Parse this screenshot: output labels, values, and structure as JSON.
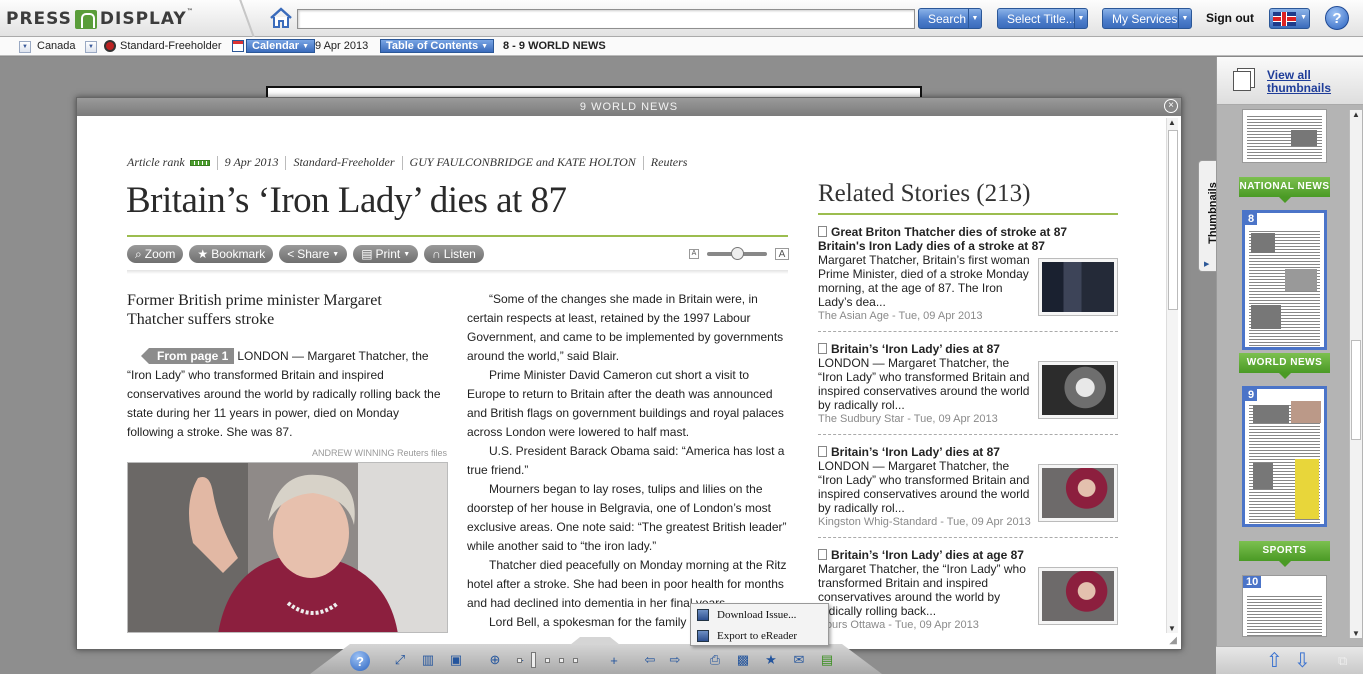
{
  "header": {
    "logo_left": "PRESS",
    "logo_right": "DISPLAY",
    "logo_tm": "™",
    "search_value": "",
    "search_button": "Search",
    "select_title_button": "Select Title...",
    "my_services_button": "My Services",
    "sign_out": "Sign out",
    "help": "?"
  },
  "subbar": {
    "country": "Canada",
    "publication": "Standard-Freeholder",
    "calendar_label": "Calendar",
    "date": "9 Apr 2013",
    "toc_label": "Table of Contents",
    "current_section": "8 - 9 WORLD NEWS"
  },
  "modal": {
    "title": "9 WORLD NEWS",
    "close": "×"
  },
  "article": {
    "rank_label": "Article rank",
    "date": "9 Apr 2013",
    "publication": "Standard-Freeholder",
    "authors": "GUY FAULCONBRIDGE and KATE HOLTON",
    "agency": "Reuters",
    "headline": "Britain’s ‘Iron Lady’ dies at 87",
    "subheadline": "Former British prime minister Margaret Thatcher suffers stroke",
    "from_page": "From page 1",
    "lead": "LONDON — Margaret Thatcher, the “Iron Lady” who transformed Britain and inspired conservatives around the world by radically rolling back the state during her 11 years in power, died on Monday following a stroke. She was 87.",
    "photo_credit": "ANDREW WINNING Reuters files",
    "col2": [
      "“Some of the changes she made in Britain were, in certain respects at least, retained by the 1997 Labour Government, and came to be implemented by governments around the world,” said Blair.",
      "Prime Minister David Cameron cut short a visit to Europe to return to Britain after the death was announced and British flags on government buildings and royal palaces across London were lowered to half mast.",
      "U.S. President Barack Obama said: “America has lost a true friend.”",
      "Mourners began to lay roses, tulips and lilies on the doorstep of her house in Belgravia, one of London’s most exclusive areas. One note said: “The greatest British leader” while another said to “the iron lady.”",
      "Thatcher died peacefully on Monday morning at the Ritz hotel after a stroke. She had been in poor health for months and had declined into dementia in her final years.",
      "Lord Bell, a spokesman for the family"
    ]
  },
  "toolbar": {
    "zoom": "Zoom",
    "bookmark": "Bookmark",
    "share": "Share",
    "print": "Print",
    "listen": "Listen",
    "font_small": "A",
    "font_large": "A"
  },
  "related": {
    "title": "Related Stories (213)",
    "stories": [
      {
        "title": "Great Briton Thatcher dies of stroke at 87",
        "subtitle": "Britain's Iron Lady dies of a stroke at 87",
        "text": "Margaret Thatcher, Britain’s first woman Prime Minister, died of a stroke Monday morning, at the age of 87. The Iron Lady’s dea...",
        "source": "The Asian Age - Tue, 09 Apr 2013"
      },
      {
        "title": "Britain’s ‘Iron Lady’ dies at 87",
        "subtitle": "",
        "text": "LONDON — Margaret Thatcher, the “Iron Lady” who transformed Britain and inspired conservatives around the world by radically rol...",
        "source": "The Sudbury Star - Tue, 09 Apr 2013"
      },
      {
        "title": "Britain’s ‘Iron Lady’ dies at 87",
        "subtitle": "",
        "text": "LONDON — Margaret Thatcher, the “Iron Lady” who transformed Britain and inspired conservatives around the world by radically rol...",
        "source": "Kingston Whig-Standard - Tue, 09 Apr 2013"
      },
      {
        "title": "Britain’s ‘Iron Lady’ dies at age 87",
        "subtitle": "",
        "text": "Margaret Thatcher, the “Iron Lady” who transformed Britain and inspired conservatives around the world by radically rolling back...",
        "source": "Hours Ottawa - Tue, 09 Apr 2013"
      }
    ]
  },
  "context_menu": {
    "download": "Download Issue...",
    "export": "Export to eReader"
  },
  "sidebar": {
    "view_all": "View all thumbnails",
    "tab": "Thumbnails",
    "sections": [
      "NATIONAL NEWS",
      "WORLD NEWS",
      "SPORTS"
    ],
    "page_numbers": [
      "8",
      "9",
      "10"
    ]
  },
  "colors": {
    "accent_blue": "#3a6bbb",
    "section_green": "#4a9a25",
    "rule_green": "#9cbd4f"
  }
}
